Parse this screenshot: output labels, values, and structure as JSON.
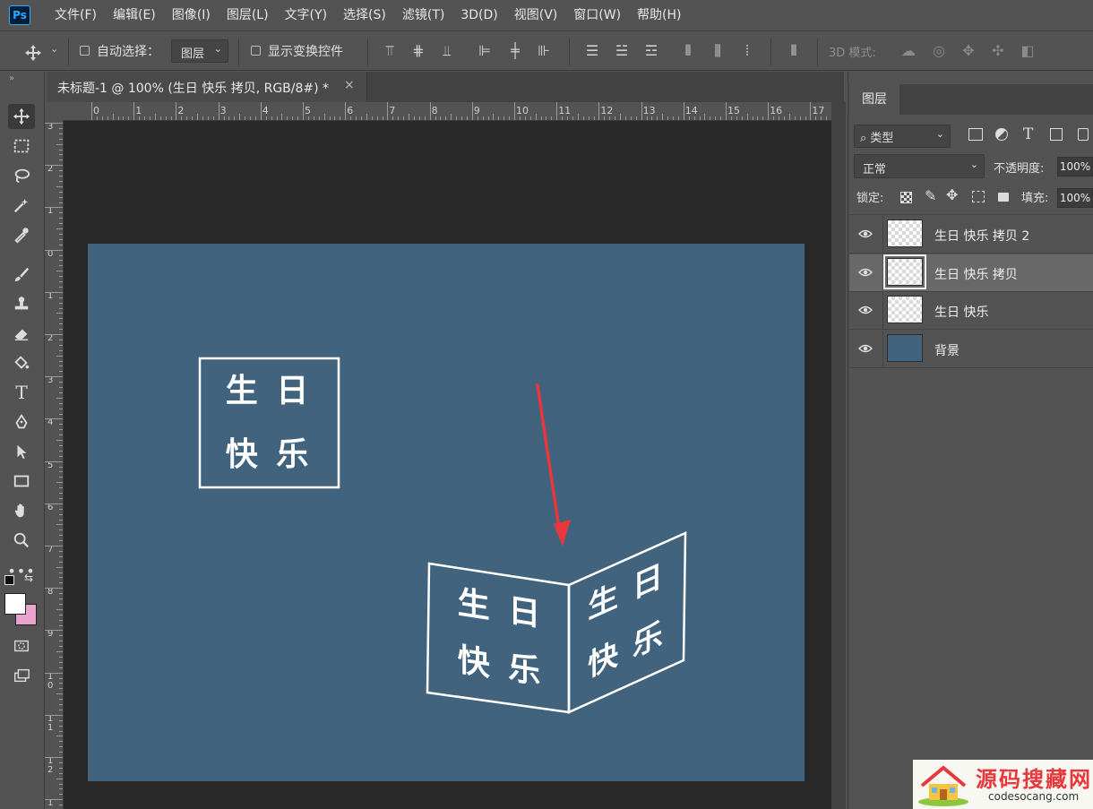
{
  "app": {
    "logo_text": "Ps"
  },
  "menu": [
    "文件(F)",
    "编辑(E)",
    "图像(I)",
    "图层(L)",
    "文字(Y)",
    "选择(S)",
    "滤镜(T)",
    "3D(D)",
    "视图(V)",
    "窗口(W)",
    "帮助(H)"
  ],
  "options": {
    "auto_select_label": "自动选择：",
    "auto_select_value": "图层",
    "show_transform_label": "显示变换控件",
    "mode_3d_label": "3D 模式:"
  },
  "document": {
    "tab_title": "未标题-1 @ 100% (生日 快乐 拷贝, RGB/8#) *",
    "close_glyph": "×",
    "ruler_top": [
      "0",
      "1",
      "2",
      "3",
      "4",
      "5",
      "6",
      "7",
      "8",
      "9",
      "10",
      "11",
      "12",
      "13",
      "14",
      "15",
      "16",
      "17"
    ],
    "ruler_left": [
      "3",
      "2",
      "1",
      "0",
      "1",
      "2",
      "3",
      "4",
      "5",
      "6",
      "7",
      "8",
      "9",
      "10",
      "11",
      "12",
      "1"
    ]
  },
  "canvas": {
    "background_color": "#41637e",
    "text_box": {
      "line1": "生 日",
      "line2": "快 乐"
    },
    "book_left": {
      "line1": "生 日",
      "line2": "快 乐"
    },
    "book_right": {
      "line1": "生 日",
      "line2": "快 乐"
    },
    "arrow_color": "#e8383d"
  },
  "layers_panel": {
    "tab_label": "图层",
    "filter_label": "类型",
    "blend_mode": "正常",
    "opacity_label": "不透明度:",
    "opacity_value": "100%",
    "lock_label": "锁定:",
    "fill_label": "填充:",
    "fill_value": "100%",
    "layers": [
      {
        "name": "生日 快乐 拷贝 2",
        "selected": false,
        "thumb": "transparent"
      },
      {
        "name": "生日 快乐 拷贝",
        "selected": true,
        "thumb": "transparent"
      },
      {
        "name": "生日 快乐",
        "selected": false,
        "thumb": "transparent"
      },
      {
        "name": "背景",
        "selected": false,
        "thumb": "fill"
      }
    ]
  },
  "watermark": {
    "title": "源码搜藏网",
    "url": "codesocang.com"
  },
  "colors": {
    "foreground": "#ffffff",
    "background": "#e9a3cf",
    "accent": "#31a8ff"
  }
}
